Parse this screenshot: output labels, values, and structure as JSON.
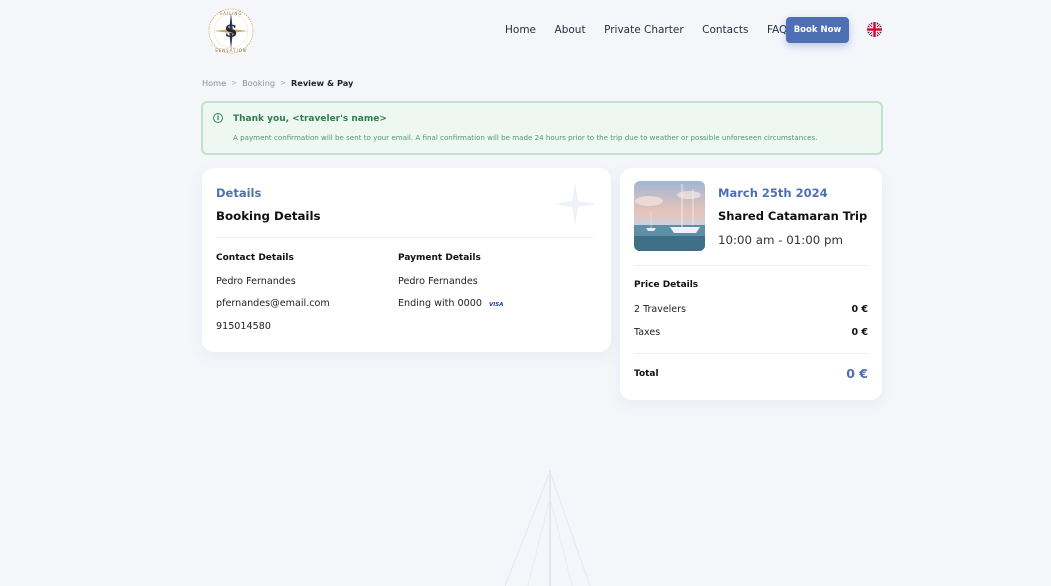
{
  "logo": {
    "icon": "sailing-sensation-compass-logo",
    "top_text": "SAILING",
    "bottom_text": "SENSATION",
    "letter": "S"
  },
  "nav": {
    "home": "Home",
    "about": "About",
    "private_charter": "Private Charter",
    "contacts": "Contacts",
    "faq": "FAQ"
  },
  "book_now": "Book Now",
  "language": {
    "icon": "uk-flag-icon"
  },
  "breadcrumb": {
    "items": [
      "Home",
      "Booking"
    ],
    "current": "Review & Pay",
    "separator": ">"
  },
  "alert": {
    "icon": "info-icon",
    "title": "Thank you, <traveler's name>",
    "message": "A payment confirmation will be sent to your email. A final confirmation will be made 24 hours prior to the trip due to weather or possible unforeseen circumstances."
  },
  "details": {
    "eyebrow": "Details",
    "title": "Booking Details",
    "contact": {
      "heading": "Contact Details",
      "name": "Pedro Fernandes",
      "email": "pfernandes@email.com",
      "phone": "915014580"
    },
    "payment": {
      "heading": "Payment Details",
      "name": "Pedro Fernandes",
      "card": "Ending with 0000",
      "card_brand": "VISA"
    }
  },
  "trip": {
    "date": "March 25th 2024",
    "name": "Shared Catamaran Trip",
    "time": "10:00 am - 01:00 pm",
    "price_heading": "Price Details",
    "lines": [
      {
        "label": "2 Travelers",
        "value": "0 €"
      },
      {
        "label": "Taxes",
        "value": "0 €"
      }
    ],
    "total_label": "Total",
    "total_value": "0 €"
  },
  "colors": {
    "accent": "#4f6fb5",
    "success_text": "#2f7d50",
    "success_bg": "#eef7f1",
    "success_border": "#bfe3cb",
    "page_bg": "#f4f6fa"
  }
}
